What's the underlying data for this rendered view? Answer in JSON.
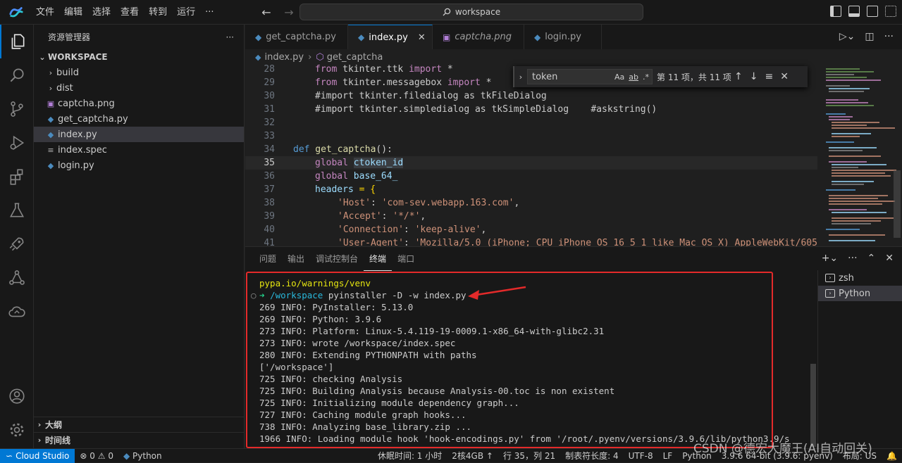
{
  "menu": [
    "文件",
    "编辑",
    "选择",
    "查看",
    "转到",
    "运行",
    "···"
  ],
  "search": {
    "label": "workspace"
  },
  "sidebar": {
    "title": "资源管理器",
    "more": "···",
    "workspace": "WORKSPACE",
    "items": [
      {
        "label": "build",
        "type": "folder"
      },
      {
        "label": "dist",
        "type": "folder"
      },
      {
        "label": "captcha.png",
        "type": "image"
      },
      {
        "label": "get_captcha.py",
        "type": "python"
      },
      {
        "label": "index.py",
        "type": "python",
        "selected": true
      },
      {
        "label": "index.spec",
        "type": "spec"
      },
      {
        "label": "login.py",
        "type": "python"
      }
    ],
    "outline": "大纲",
    "timeline": "时间线"
  },
  "tabs": [
    {
      "label": "get_captcha.py"
    },
    {
      "label": "index.py",
      "active": true
    },
    {
      "label": "captcha.png",
      "italic": true
    },
    {
      "label": "login.py"
    }
  ],
  "breadcrumb": {
    "file": "index.py",
    "symbol": "get_captcha"
  },
  "find": {
    "query": "token",
    "count": "第 11 项，共 11 项",
    "opt_case": "Aa",
    "opt_word": "ab",
    "opt_regex": ".*"
  },
  "code": {
    "n28": "28",
    "n29": "29",
    "n30": "30",
    "n31": "31",
    "n32": "32",
    "n33": "33",
    "n34": "34",
    "n35": "35",
    "n36": "36",
    "n37": "37",
    "n38": "38",
    "n39": "39",
    "n40": "40",
    "n41": "41",
    "l28a": "from",
    "l28b": " tkinter.ttk ",
    "l28c": "import",
    "l28d": " *",
    "l29a": "from",
    "l29b": " tkinter.messagebox ",
    "l29c": "import",
    "l29d": " *",
    "l30": "#import tkinter.filedialog as tkFileDialog",
    "l31": "#import tkinter.simpledialog as tkSimpleDialog    #askstring()",
    "l34a": "def",
    "l34b": " get_captcha",
    "l34c": "():",
    "l35a": "global",
    "l35b": "ctoken_id",
    "l36a": "global",
    "l36b": " base_64_",
    "l37a": "headers",
    "l37b": " = {",
    "l38a": "'Host'",
    "l38b": ": ",
    "l38c": "'com-sev.webapp.163.com'",
    "l38d": ",",
    "l39a": "'Accept'",
    "l39b": ": ",
    "l39c": "'*/*'",
    "l39d": ",",
    "l40a": "'Connection'",
    "l40b": ": ",
    "l40c": "'keep-alive'",
    "l40d": ",",
    "l41a": "'User-Agent'",
    "l41b": ": ",
    "l41c": "'Mozilla/5.0 (iPhone; CPU iPhone OS 16_5_1 like Mac OS X) AppleWebKit/605.1"
  },
  "panel": {
    "tabs": [
      "问题",
      "输出",
      "调试控制台",
      "终端",
      "端口"
    ],
    "active": "终端",
    "terminals": [
      {
        "label": "zsh"
      },
      {
        "label": "Python",
        "selected": true
      }
    ]
  },
  "terminal": {
    "l0": "pypa.io/warnings/venv",
    "prompt_arrow": "➜",
    "prompt_dir": "/workspace",
    "prompt_cmd": " pyinstaller -D -w index.py",
    "lines": [
      "269 INFO: PyInstaller: 5.13.0",
      "269 INFO: Python: 3.9.6",
      "273 INFO: Platform: Linux-5.4.119-19-0009.1-x86_64-with-glibc2.31",
      "273 INFO: wrote /workspace/index.spec",
      "280 INFO: Extending PYTHONPATH with paths",
      "['/workspace']",
      "725 INFO: checking Analysis",
      "725 INFO: Building Analysis because Analysis-00.toc is non existent",
      "725 INFO: Initializing module dependency graph...",
      "727 INFO: Caching module graph hooks...",
      "738 INFO: Analyzing base_library.zip ...",
      "1966 INFO: Loading module hook 'hook-encodings.py' from '/root/.pyenv/versions/3.9.6/lib/python3.9/s"
    ]
  },
  "status": {
    "remote": "Cloud Studio",
    "errors": "0",
    "warnings": "0",
    "lang_left": "Python",
    "rest": "休眠时间: 1 小时",
    "spec": "2核4GB ↑",
    "pos": "行 35，列 21",
    "tab": "制表符长度: 4",
    "enc": "UTF-8",
    "eol": "LF",
    "lang": "Python",
    "interp": "3.9.6 64-bit (3.9.6: pyenv)",
    "layout": "布局: US"
  },
  "watermark": "CSDN @德宏大魔王(AI自动回关)",
  "colors": {
    "accent": "#0078d4",
    "annotation": "#e32a2a",
    "prompt": "#23d18b"
  }
}
